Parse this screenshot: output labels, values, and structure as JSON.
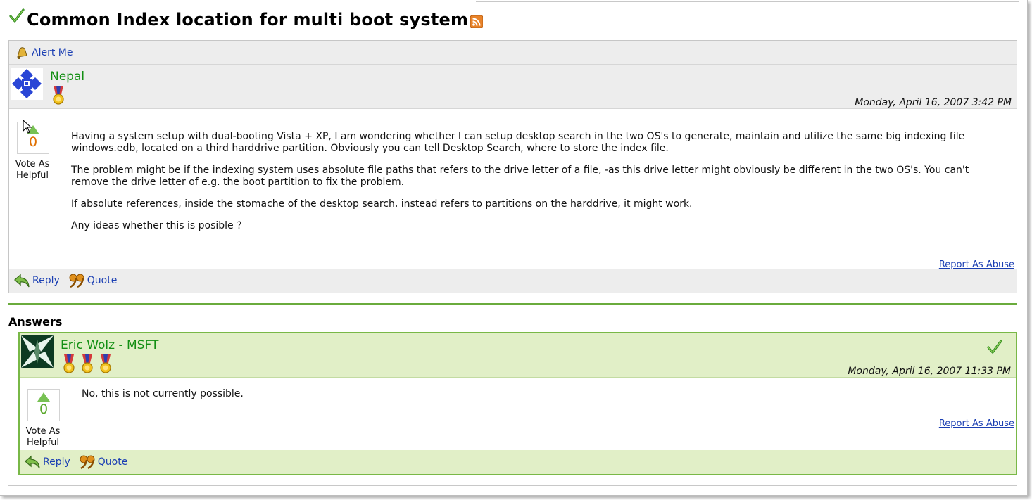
{
  "thread": {
    "title": "Common Index location for multi boot system",
    "alert_label": "Alert Me"
  },
  "question": {
    "author": "Nepal",
    "date": "Monday, April 16, 2007 3:42 PM",
    "votes": "0",
    "vote_label_line1": "Vote As",
    "vote_label_line2": "Helpful",
    "paragraphs": [
      "Having a system setup with dual-booting Vista + XP, I am wondering whether I can setup desktop search in the two OS's to generate, maintain and utilize the same big indexing file windows.edb, located on a third harddrive partition. Obviously you can tell Desktop Search, where to store the index file.",
      "The problem might be if the indexing system uses absolute file paths that refers to the drive letter of a file, -as this drive letter might obviously be different in the two OS's. You can't remove the drive letter of e.g. the boot partition to fix the problem.",
      "If absolute references, inside the stomache of the desktop search, instead refers to partitions on the harddrive, it might work.",
      "Any ideas whether this is posible ?"
    ],
    "report_label": "Report As Abuse",
    "reply_label": "Reply",
    "quote_label": "Quote"
  },
  "answers_heading": "Answers",
  "answer": {
    "author": "Eric Wolz - MSFT",
    "date": "Monday, April 16, 2007 11:33 PM",
    "votes": "0",
    "vote_label_line1": "Vote As",
    "vote_label_line2": "Helpful",
    "body": "No, this is not currently possible.",
    "report_label": "Report As Abuse",
    "reply_label": "Reply",
    "quote_label": "Quote"
  },
  "colors": {
    "link": "#1b3fb3",
    "author_name": "#138f13",
    "answer_border": "#79b847",
    "answer_bg": "#e1efc7",
    "question_bar_bg": "#ededed",
    "vote_count_question": "#e07000",
    "vote_count_answer": "#5aa82c"
  },
  "icons": {
    "title": "checkmark-icon",
    "feed": "rss-icon",
    "alert": "bell-icon",
    "reply": "reply-arrow-icon",
    "quote": "quote-icon",
    "medal": "medal-icon",
    "answer_mark": "checkmark-icon"
  }
}
